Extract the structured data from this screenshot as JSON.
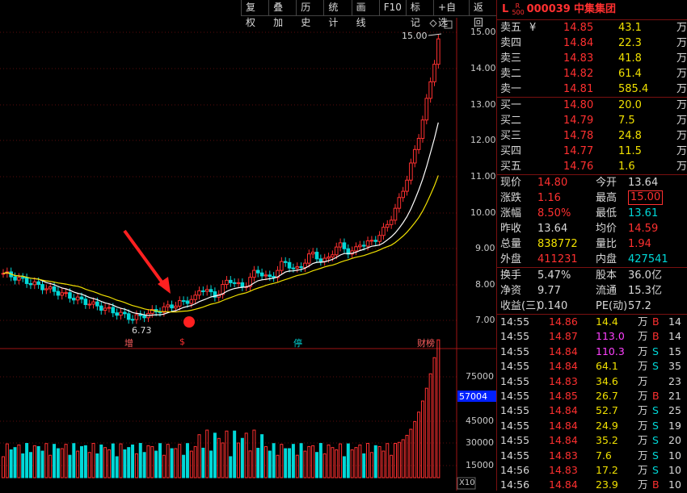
{
  "toolbar": [
    "复权",
    "叠加",
    "历史",
    "统计",
    "画线",
    "F10",
    "标记",
    "+自选",
    "返回"
  ],
  "price_axis": [
    "15.00",
    "14.00",
    "13.00",
    "12.00",
    "11.00",
    "10.00",
    "9.00",
    "8.00",
    "7.00"
  ],
  "volume_axis": [
    "75000",
    "45000",
    "30000",
    "15000"
  ],
  "volume_label": "57004",
  "volume_unit": "X10",
  "annotations": {
    "high": "15.00",
    "low": "6.73"
  },
  "markers": [
    "增",
    "$",
    "停",
    "财榜"
  ],
  "stock": {
    "flag": "L",
    "badge_top": "R",
    "badge_bottom": "500",
    "code": "000039",
    "name": "中集集团"
  },
  "asks": [
    {
      "label": "卖五",
      "mark": "¥",
      "price": "14.85",
      "vol": "43.1",
      "unit": "万"
    },
    {
      "label": "卖四",
      "mark": "",
      "price": "14.84",
      "vol": "22.3",
      "unit": "万"
    },
    {
      "label": "卖三",
      "mark": "",
      "price": "14.83",
      "vol": "41.8",
      "unit": "万"
    },
    {
      "label": "卖二",
      "mark": "",
      "price": "14.82",
      "vol": "61.4",
      "unit": "万"
    },
    {
      "label": "卖一",
      "mark": "",
      "price": "14.81",
      "vol": "585.4",
      "unit": "万"
    }
  ],
  "bids": [
    {
      "label": "买一",
      "price": "14.80",
      "vol": "20.0",
      "unit": "万"
    },
    {
      "label": "买二",
      "price": "14.79",
      "vol": "7.5",
      "unit": "万"
    },
    {
      "label": "买三",
      "price": "14.78",
      "vol": "24.8",
      "unit": "万"
    },
    {
      "label": "买四",
      "price": "14.77",
      "vol": "11.5",
      "unit": "万"
    },
    {
      "label": "买五",
      "price": "14.76",
      "vol": "1.6",
      "unit": "万"
    }
  ],
  "quote": [
    {
      "l1": "现价",
      "v1": "14.80",
      "c1": "red",
      "l2": "今开",
      "v2": "13.64",
      "c2": "wht"
    },
    {
      "l1": "涨跌",
      "v1": "1.16",
      "c1": "red",
      "l2": "最高",
      "v2": "15.00",
      "c2": "red",
      "box": true
    },
    {
      "l1": "涨幅",
      "v1": "8.50%",
      "c1": "red",
      "l2": "最低",
      "v2": "13.61",
      "c2": "cyan"
    },
    {
      "l1": "昨收",
      "v1": "13.64",
      "c1": "wht",
      "l2": "均价",
      "v2": "14.59",
      "c2": "red"
    },
    {
      "l1": "总量",
      "v1": "838772",
      "c1": "yel",
      "l2": "量比",
      "v2": "1.94",
      "c2": "red"
    },
    {
      "l1": "外盘",
      "v1": "411231",
      "c1": "red",
      "l2": "内盘",
      "v2": "427541",
      "c2": "cyan"
    }
  ],
  "stats": [
    {
      "l1": "换手",
      "v1": "5.47%",
      "l2": "股本",
      "v2": "36.0亿"
    },
    {
      "l1": "净资",
      "v1": "9.77",
      "l2": "流通",
      "v2": "15.3亿"
    },
    {
      "l1": "收益(三)",
      "v1": "0.140",
      "l2": "PE(动)",
      "v2": "57.2"
    }
  ],
  "ticks": [
    {
      "t": "14:55",
      "p": "14.86",
      "v": "14.4",
      "u": "万",
      "bs": "B",
      "n": "14",
      "vc": "yel"
    },
    {
      "t": "14:55",
      "p": "14.87",
      "v": "113.0",
      "u": "万",
      "bs": "B",
      "n": "14",
      "vc": "mag"
    },
    {
      "t": "14:55",
      "p": "14.84",
      "v": "110.3",
      "u": "万",
      "bs": "S",
      "n": "15",
      "vc": "mag"
    },
    {
      "t": "14:55",
      "p": "14.84",
      "v": "64.1",
      "u": "万",
      "bs": "S",
      "n": "35",
      "vc": "yel"
    },
    {
      "t": "14:55",
      "p": "14.83",
      "v": "34.6",
      "u": "万",
      "bs": "",
      "n": "23",
      "vc": "yel"
    },
    {
      "t": "14:55",
      "p": "14.85",
      "v": "26.7",
      "u": "万",
      "bs": "B",
      "n": "21",
      "vc": "yel"
    },
    {
      "t": "14:55",
      "p": "14.84",
      "v": "52.7",
      "u": "万",
      "bs": "S",
      "n": "25",
      "vc": "yel"
    },
    {
      "t": "14:55",
      "p": "14.84",
      "v": "24.9",
      "u": "万",
      "bs": "S",
      "n": "19",
      "vc": "yel"
    },
    {
      "t": "14:55",
      "p": "14.84",
      "v": "35.2",
      "u": "万",
      "bs": "S",
      "n": "20",
      "vc": "yel"
    },
    {
      "t": "14:55",
      "p": "14.83",
      "v": "7.6",
      "u": "万",
      "bs": "S",
      "n": "10",
      "vc": "yel"
    },
    {
      "t": "14:56",
      "p": "14.83",
      "v": "17.2",
      "u": "万",
      "bs": "S",
      "n": "10",
      "vc": "yel"
    },
    {
      "t": "14:56",
      "p": "14.84",
      "v": "23.9",
      "u": "万",
      "bs": "B",
      "n": "10",
      "vc": "yel"
    }
  ]
}
